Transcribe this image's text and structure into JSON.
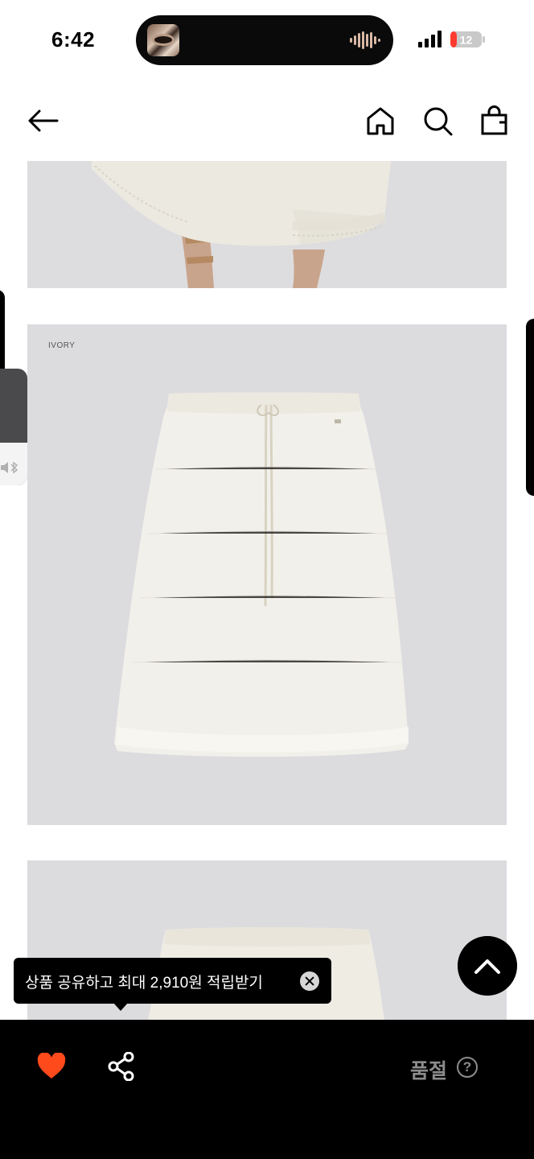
{
  "status_bar": {
    "time": "6:42",
    "battery_level": "12",
    "battery_color": "#ff3b30"
  },
  "nav": {
    "back_icon": "arrow-left-icon",
    "home_icon": "home-icon",
    "search_icon": "search-icon",
    "bag_icon": "shopping-bag-icon"
  },
  "product": {
    "color_label": "IVORY"
  },
  "tooltip": {
    "text": "상품 공유하고 최대 2,910원 적립받기"
  },
  "bottom_bar": {
    "like_icon": "heart-icon",
    "like_color": "#ff4a1c",
    "share_icon": "share-icon",
    "status_label": "품절",
    "help_label": "?"
  }
}
